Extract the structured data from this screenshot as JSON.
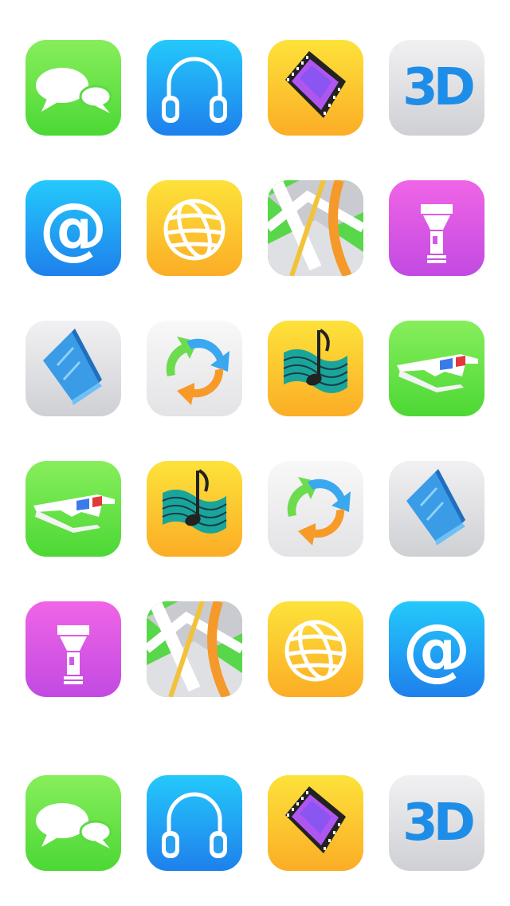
{
  "icons": [
    {
      "name": "messages",
      "color": "green"
    },
    {
      "name": "headphones",
      "color": "blue"
    },
    {
      "name": "film",
      "color": "yellow"
    },
    {
      "name": "3d",
      "color": "gray",
      "text": "3D"
    },
    {
      "name": "email",
      "color": "blue",
      "text": "@"
    },
    {
      "name": "globe",
      "color": "yellow"
    },
    {
      "name": "map",
      "color": "green"
    },
    {
      "name": "flashlight",
      "color": "pink"
    },
    {
      "name": "book",
      "color": "gray"
    },
    {
      "name": "sync",
      "color": "light"
    },
    {
      "name": "music",
      "color": "yellow"
    },
    {
      "name": "3d-glasses",
      "color": "green"
    },
    {
      "name": "3d-glasses",
      "color": "green"
    },
    {
      "name": "music",
      "color": "yellow"
    },
    {
      "name": "sync",
      "color": "light"
    },
    {
      "name": "book",
      "color": "gray"
    },
    {
      "name": "flashlight",
      "color": "pink"
    },
    {
      "name": "map",
      "color": "green"
    },
    {
      "name": "globe",
      "color": "yellow"
    },
    {
      "name": "email",
      "color": "blue",
      "text": "@"
    },
    {
      "name": "messages",
      "color": "green"
    },
    {
      "name": "headphones",
      "color": "blue"
    },
    {
      "name": "film",
      "color": "yellow"
    },
    {
      "name": "3d",
      "color": "gray",
      "text": "3D"
    }
  ]
}
